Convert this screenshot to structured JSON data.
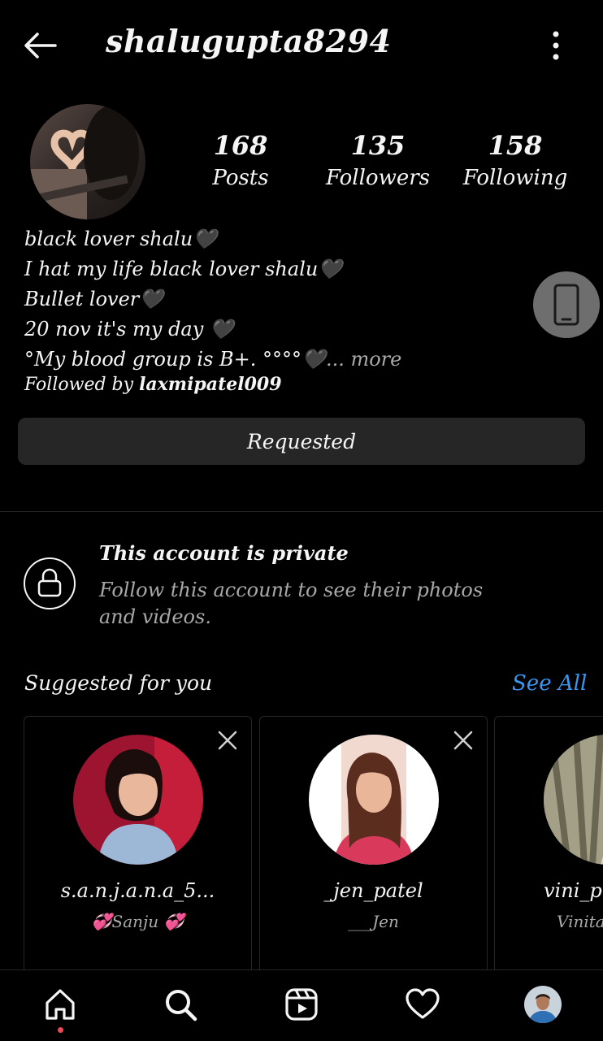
{
  "header": {
    "username": "shalugupta8294",
    "back_icon": "back-arrow-icon",
    "menu_icon": "more-vertical-icon"
  },
  "profile": {
    "stats": [
      {
        "value": "168",
        "label": "Posts"
      },
      {
        "value": "135",
        "label": "Followers"
      },
      {
        "value": "158",
        "label": "Following"
      }
    ],
    "bio_lines": [
      "black lover shalu🖤",
      "I hat my life  black lover shalu🖤",
      "Bullet lover🖤",
      "20 nov it's my day  🖤",
      "°My blood group is B+. °°°°🖤"
    ],
    "more_label": "... more",
    "followed_prefix": "Followed by ",
    "followed_by": "laxmipatel009",
    "requested_label": "Requested"
  },
  "private_notice": {
    "title": "This account is private",
    "subtitle": "Follow this account to see their photos and videos."
  },
  "suggestions": {
    "title": "Suggested for you",
    "see_all": "See All",
    "cards": [
      {
        "username": "s.a.n.j.a.n.a_5...",
        "name": "💞Sanju 💞"
      },
      {
        "username": "_jen_patel",
        "name": "___Jen"
      },
      {
        "username": "vini_p",
        "name": "Vinita"
      }
    ]
  },
  "bottom_nav": {
    "items": [
      "home-icon",
      "search-icon",
      "reels-icon",
      "heart-icon",
      "profile-avatar"
    ]
  },
  "colors": {
    "background": "#000000",
    "button": "#262626",
    "link": "#3897f0",
    "muted": "#a8a8a8",
    "notification_dot": "#ed4956"
  }
}
